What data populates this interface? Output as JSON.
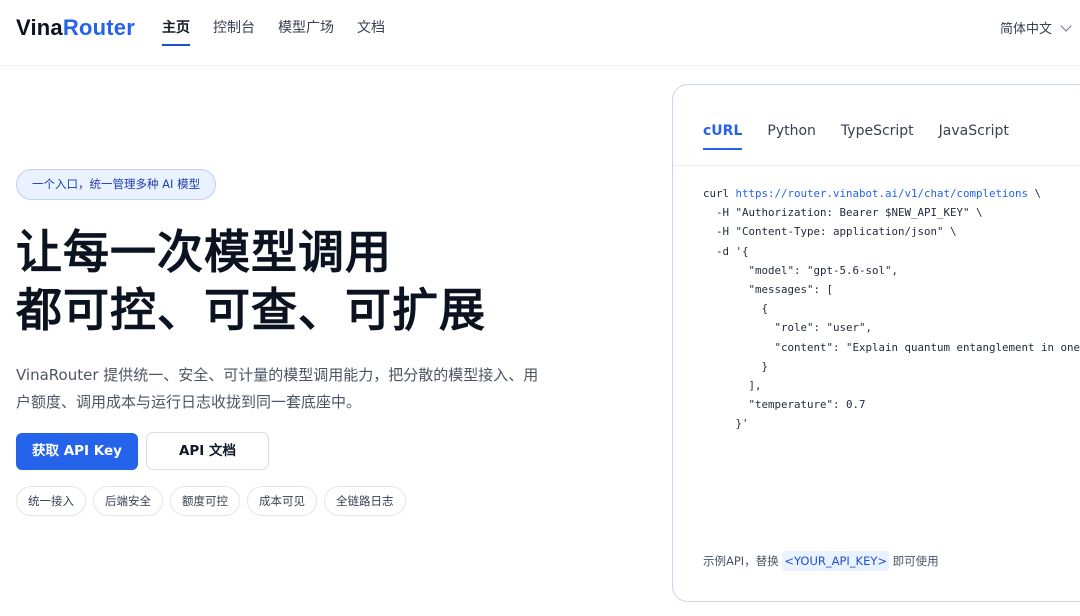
{
  "header": {
    "logo_main": "Vina",
    "logo_accent": "Router",
    "nav": [
      "主页",
      "控制台",
      "模型广场",
      "文档"
    ],
    "language": "简体中文"
  },
  "hero": {
    "pill": "一个入口，统一管理多种 AI 模型",
    "title_line1": "让每一次模型调用",
    "title_line2": "都可控、可查、可扩展",
    "description": "VinaRouter 提供统一、安全、可计量的模型调用能力，把分散的模型接入、用户额度、调用成本与运行日志收拢到同一套底座中。",
    "primary_button": "获取 API Key",
    "secondary_button": "API 文档",
    "tags": [
      "统一接入",
      "后端安全",
      "额度可控",
      "成本可见",
      "全链路日志"
    ]
  },
  "code_panel": {
    "tabs": [
      "cURL",
      "Python",
      "TypeScript",
      "JavaScript"
    ],
    "active_tab": "cURL",
    "code_prefix": "curl ",
    "code_url": "https://router.vinabot.ai/v1/chat/completions",
    "code_after_url": " \\",
    "code_body": "  -H \"Authorization: Bearer $NEW_API_KEY\" \\\n  -H \"Content-Type: application/json\" \\\n  -d '{\n       \"model\": \"gpt-5.6-sol\",\n       \"messages\": [\n         {\n           \"role\": \"user\",\n           \"content\": \"Explain quantum entanglement in one p\n         }\n       ],\n       \"temperature\": 0.7\n     }'",
    "hint_before": "示例API，替换 ",
    "hint_key": "<YOUR_API_KEY>",
    "hint_after": " 即可使用"
  },
  "colors": {
    "accent": "#2563eb",
    "text_dark": "#0b1220",
    "panel_border": "#c9d7f2"
  }
}
